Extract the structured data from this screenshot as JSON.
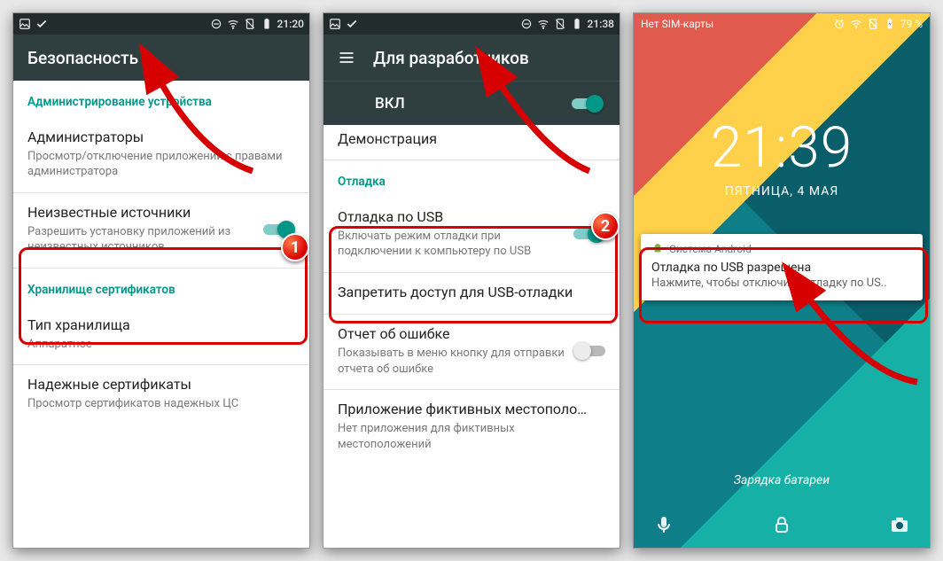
{
  "s1": {
    "status_time": "21:20",
    "title": "Безопасность",
    "section_admin": "Администрирование устройства",
    "admins_title": "Администраторы",
    "admins_sub": "Просмотр/отключение приложений с правами администратора",
    "unknown_title": "Неизвестные источники",
    "unknown_sub": "Разрешить установку приложений из неизвестных источников",
    "section_cert": "Хранилище сертификатов",
    "storage_type_title": "Тип хранилища",
    "storage_type_sub": "Аппаратное",
    "trusted_title": "Надежные сертификаты",
    "trusted_sub": "Просмотр сертификатов надежных ЦС",
    "badge": "1"
  },
  "s2": {
    "status_time": "21:38",
    "title": "Для разработчиков",
    "on_label": "ВКЛ",
    "demo": "Демонстрация",
    "section_debug": "Отладка",
    "usb_title": "Отладка по USB",
    "usb_sub": "Включать режим отладки при подключении к компьютеру по USB",
    "revoke": "Запретить доступ для USB-отладки",
    "bugreport_title": "Отчет об ошибке",
    "bugreport_sub": "Показывать в меню кнопку для отправки отчета об ошибке",
    "mock_title": "Приложение фиктивных местополо…",
    "mock_sub": "Нет приложения для фиктивных местоположений",
    "badge": "2"
  },
  "s3": {
    "sim": "Нет SIM-карты",
    "battery_pct": "79 %",
    "clock": "21:39",
    "date": "ПЯТНИЦА, 4 МАЯ",
    "notif_app": "Система Android",
    "notif_title": "Отладка по USB разрешена",
    "notif_sub": "Нажмите, чтобы отключить отладку по US..",
    "charging": "Зарядка батареи"
  }
}
